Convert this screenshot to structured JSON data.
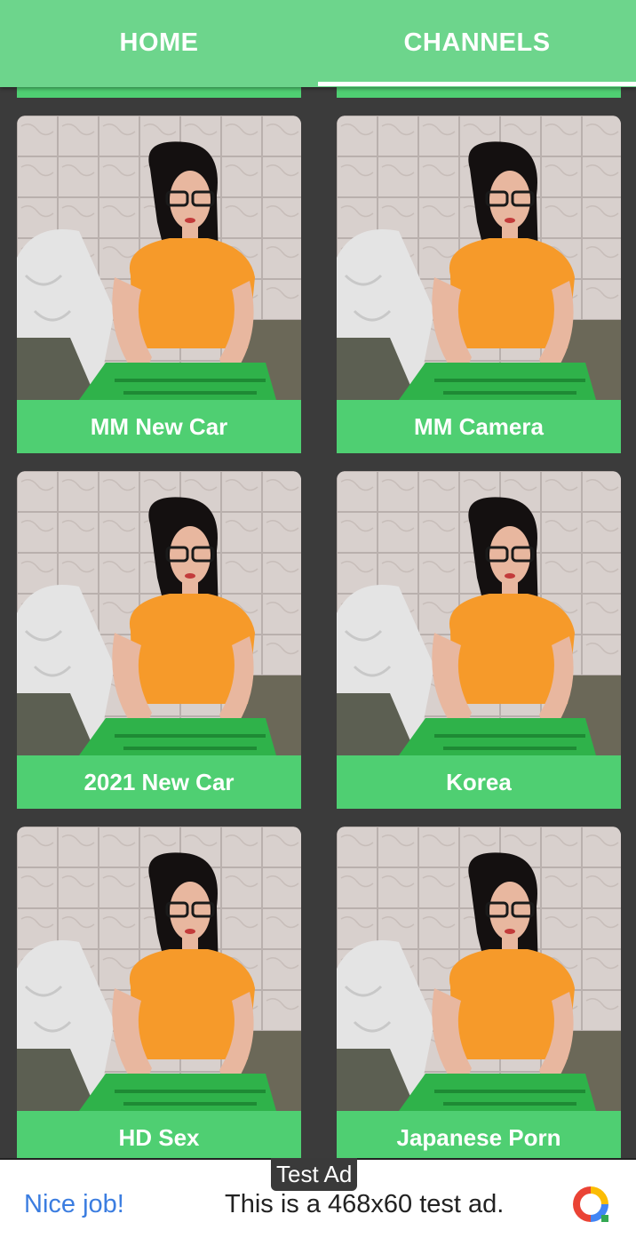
{
  "tabs": {
    "home": "HOME",
    "channels": "CHANNELS"
  },
  "channels": [
    {
      "label": "MM New Car"
    },
    {
      "label": "MM Camera"
    },
    {
      "label": "2021 New Car"
    },
    {
      "label": "Korea"
    },
    {
      "label": "HD Sex"
    },
    {
      "label": "Japanese Porn"
    }
  ],
  "ad": {
    "badge": "Test Ad",
    "nice": "Nice job!",
    "text": "This is a 468x60 test ad."
  },
  "colors": {
    "accent": "#6dd58c",
    "card_label": "#4fcf72",
    "background": "#3b3b3b"
  }
}
